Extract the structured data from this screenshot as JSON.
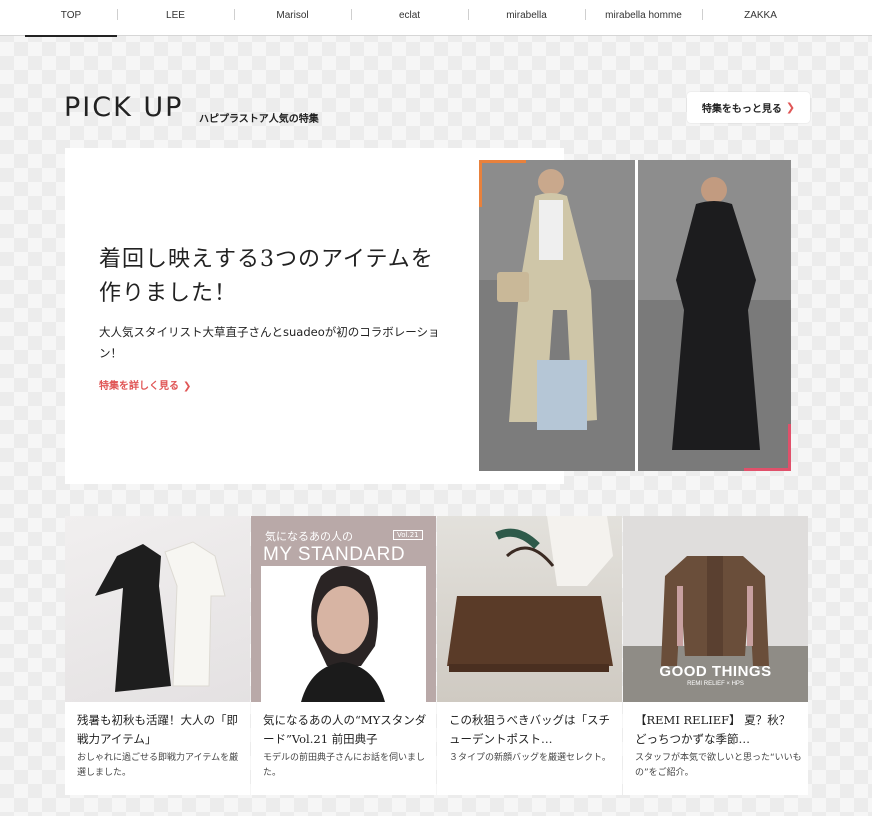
{
  "nav": {
    "items": [
      "TOP",
      "LEE",
      "Marisol",
      "eclat",
      "mirabella",
      "mirabella homme",
      "ZAKKA"
    ],
    "active": "TOP"
  },
  "pickup": {
    "title": "PICK UP",
    "subtitle": "ハピプラストア人気の特集",
    "more_label": "特集をもっと見る",
    "more_icon": "chevron-right-icon"
  },
  "feature": {
    "headline": "着回し映えする3つのアイテムを作りました！",
    "description": "大人気スタイリスト大草直子さんとsuadeoが初のコラボレーション！",
    "link_label": "特集を詳しく見る",
    "accent_colors": {
      "top_left": "#e8813c",
      "bottom_right": "#e0506a",
      "link": "#e05656"
    }
  },
  "articles": [
    {
      "title": "残暑も初秋も活躍！大人の「即戦力アイテム」",
      "desc": "おしゃれに過ごせる即戦力アイテムを厳選しました。"
    },
    {
      "title": "気になるあの人の“MYスタンダード”Vol.21 前田典子",
      "desc": "モデルの前田典子さんにお話を伺いました。",
      "thumb_text": {
        "kicker": "気になるあの人の",
        "vol": "Vol.21",
        "heading": "MY STANDARD"
      }
    },
    {
      "title": "この秋狙うべきバッグは「スチューデントポスト…",
      "desc": "３タイプの新顔バッグを厳選セレクト。"
    },
    {
      "title": "【REMI RELIEF】 夏？秋？どっちつかずな季節…",
      "desc": "スタッフが本気で欲しいと思った“いいもの”をご紹介。",
      "thumb_text": {
        "heading": "GOOD THINGS",
        "sub": "REMI RELIEF × HPS"
      }
    }
  ]
}
